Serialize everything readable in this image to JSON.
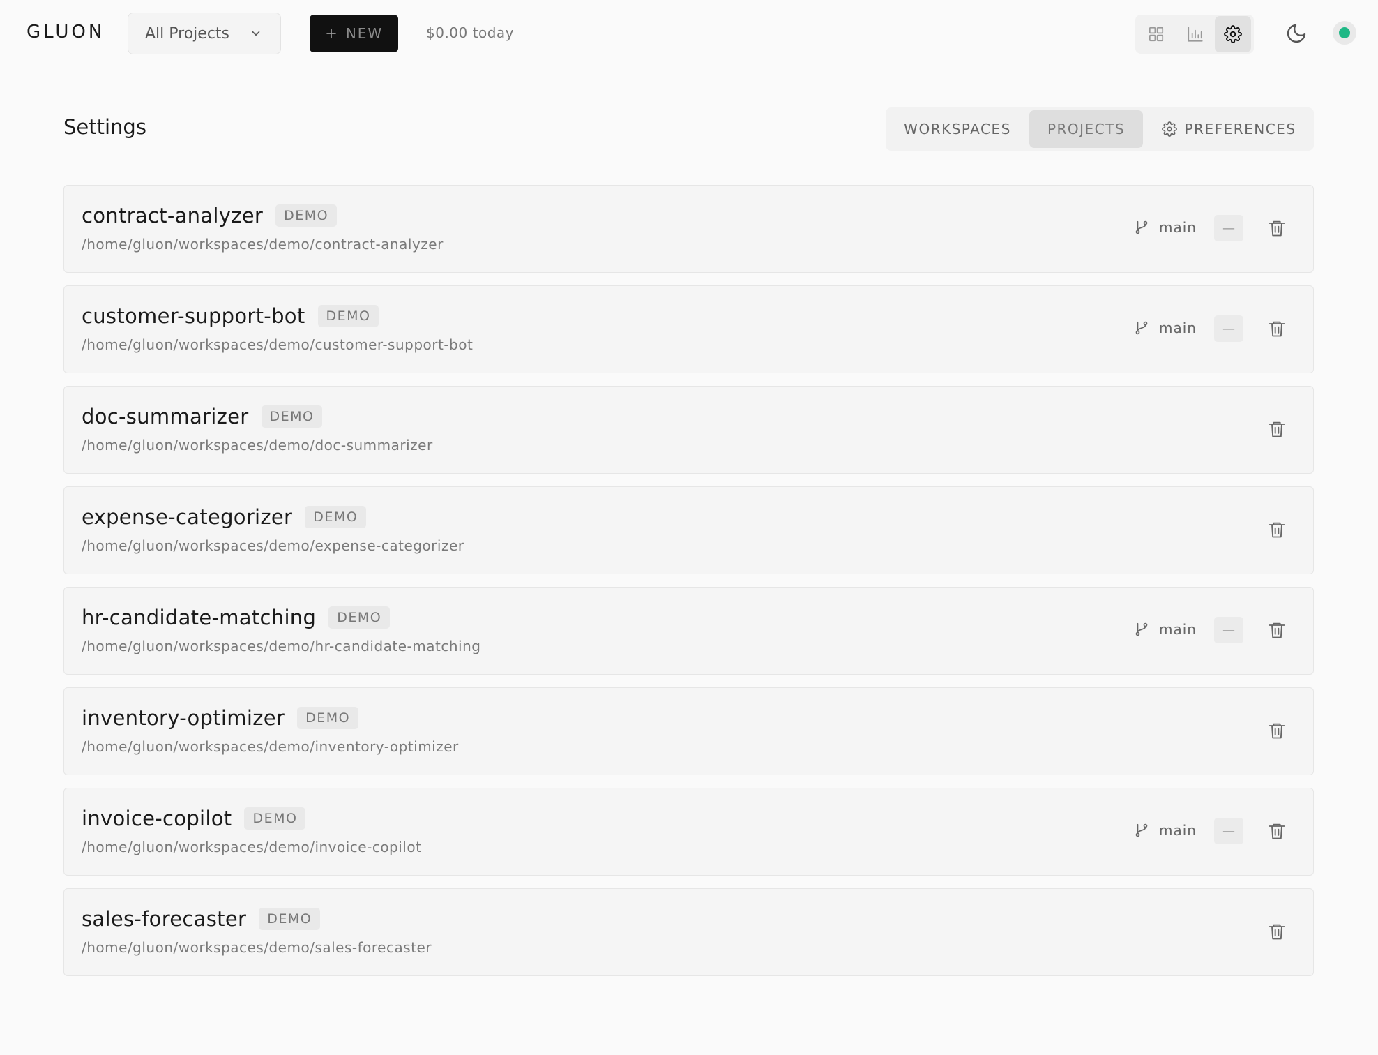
{
  "app": {
    "logo": "GLUON",
    "project_select": {
      "value": "All Projects"
    },
    "new_button": {
      "label": "NEW"
    },
    "cost_today": "$0.00 today",
    "view_buttons": [
      "grid-icon",
      "bar-chart-icon",
      "gear-icon"
    ],
    "active_view": "gear-icon",
    "theme_toggle_icon": "moon-icon",
    "status_color": "#1fb886"
  },
  "page": {
    "title": "Settings",
    "tabs": [
      {
        "label": "WORKSPACES",
        "active": false
      },
      {
        "label": "PROJECTS",
        "active": true
      },
      {
        "label": "PREFERENCES",
        "active": false,
        "icon": "gear-icon"
      }
    ]
  },
  "projects": [
    {
      "name": "contract-analyzer",
      "badge": "DEMO",
      "path": "/home/gluon/workspaces/demo/contract-analyzer",
      "branch": "main",
      "dash": "—"
    },
    {
      "name": "customer-support-bot",
      "badge": "DEMO",
      "path": "/home/gluon/workspaces/demo/customer-support-bot",
      "branch": "main",
      "dash": "—"
    },
    {
      "name": "doc-summarizer",
      "badge": "DEMO",
      "path": "/home/gluon/workspaces/demo/doc-summarizer",
      "branch": null,
      "dash": null
    },
    {
      "name": "expense-categorizer",
      "badge": "DEMO",
      "path": "/home/gluon/workspaces/demo/expense-categorizer",
      "branch": null,
      "dash": null
    },
    {
      "name": "hr-candidate-matching",
      "badge": "DEMO",
      "path": "/home/gluon/workspaces/demo/hr-candidate-matching",
      "branch": "main",
      "dash": "—"
    },
    {
      "name": "inventory-optimizer",
      "badge": "DEMO",
      "path": "/home/gluon/workspaces/demo/inventory-optimizer",
      "branch": null,
      "dash": null
    },
    {
      "name": "invoice-copilot",
      "badge": "DEMO",
      "path": "/home/gluon/workspaces/demo/invoice-copilot",
      "branch": "main",
      "dash": "—"
    },
    {
      "name": "sales-forecaster",
      "badge": "DEMO",
      "path": "/home/gluon/workspaces/demo/sales-forecaster",
      "branch": null,
      "dash": null
    }
  ]
}
